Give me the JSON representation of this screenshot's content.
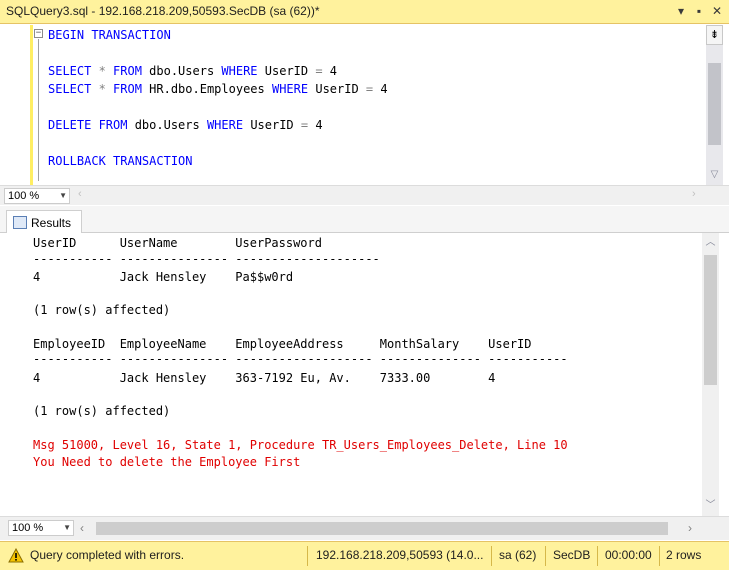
{
  "window": {
    "tab_title": "SQLQuery3.sql - 192.168.218.209,50593.SecDB (sa (62))*",
    "dropdown_glyph": "▾",
    "pin_glyph": "▪",
    "close_glyph": "✕"
  },
  "editor": {
    "collapse_glyph": "−",
    "lines": [
      {
        "kw1": "BEGIN TRANSACTION"
      },
      {
        "kw1": "SELECT ",
        "gr1": "* ",
        "kw2": "FROM ",
        "tx1": "dbo.Users ",
        "kw3": "WHERE ",
        "tx2": "UserID ",
        "gr2": "= ",
        "tx3": "4"
      },
      {
        "kw1": "SELECT ",
        "gr1": "* ",
        "kw2": "FROM ",
        "tx1": "HR.dbo.Employees ",
        "kw3": "WHERE ",
        "tx2": "UserID ",
        "gr2": "= ",
        "tx3": "4"
      },
      {
        "kw1": "DELETE ",
        "kw2": "FROM ",
        "tx1": "dbo.Users ",
        "kw3": "WHERE ",
        "tx2": "UserID ",
        "gr2": "= ",
        "tx3": "4"
      },
      {
        "kw1": "ROLLBACK TRANSACTION"
      }
    ],
    "zoom": "100 %"
  },
  "results": {
    "tab_label": "Results",
    "table1": {
      "headers": "UserID      UserName        UserPassword",
      "dashes": "----------- --------------- --------------------",
      "row": "4           Jack Hensley    Pa$$w0rd",
      "affected": "(1 row(s) affected)"
    },
    "table2": {
      "headers": "EmployeeID  EmployeeName    EmployeeAddress     MonthSalary    UserID",
      "dashes": "----------- --------------- ------------------- -------------- -----------",
      "row": "4           Jack Hensley    363-7192 Eu, Av.    7333.00        4",
      "affected": "(1 row(s) affected)"
    },
    "error_line1": "Msg 51000, Level 16, State 1, Procedure TR_Users_Employees_Delete, Line 10",
    "error_line2": "You Need to delete the Employee First",
    "zoom": "100 %"
  },
  "status": {
    "message": "Query completed with errors.",
    "server": "192.168.218.209,50593 (14.0...",
    "user": "sa (62)",
    "database": "SecDB",
    "elapsed": "00:00:00",
    "rows": "2 rows"
  },
  "colors": {
    "title_bg": "#fff29d",
    "keyword": "#0000ff",
    "error": "#e00000"
  }
}
